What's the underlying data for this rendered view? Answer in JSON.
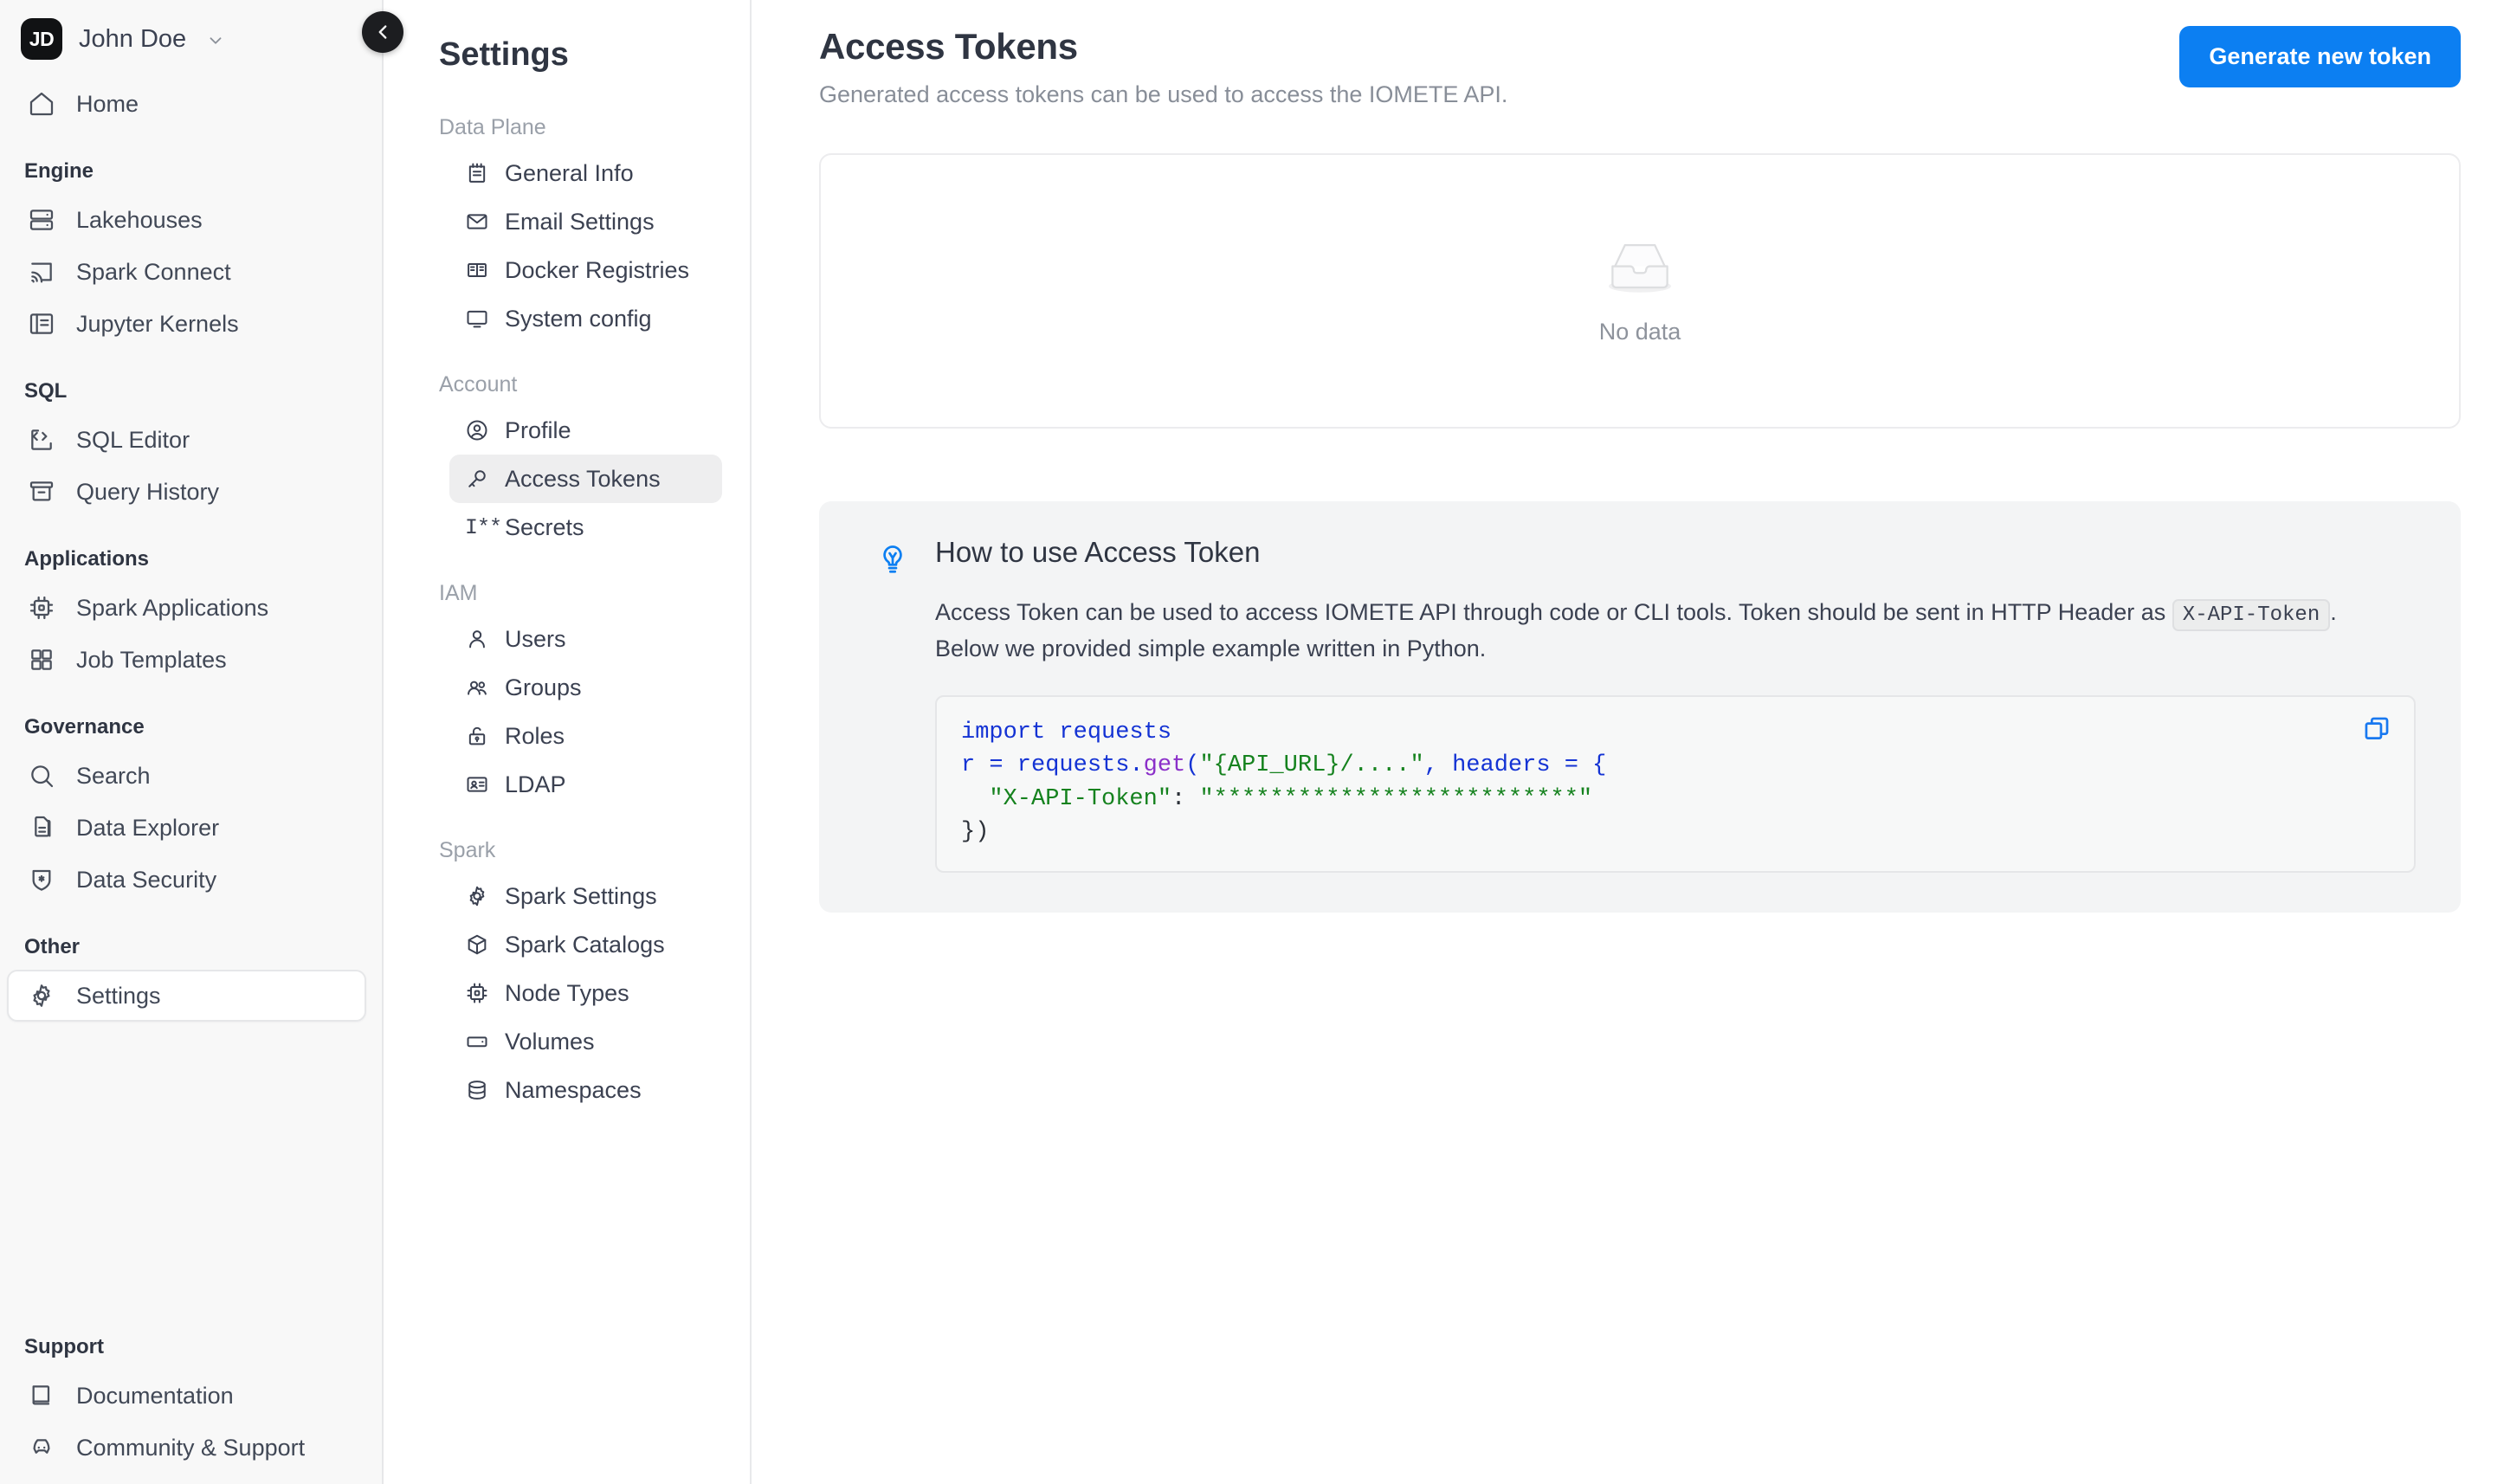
{
  "left_nav": {
    "user": {
      "initials": "JD",
      "name": "John Doe"
    },
    "collapse_tooltip": "Collapse sidebar",
    "top_item": {
      "label": "Home",
      "icon": "home-icon"
    },
    "groups": [
      {
        "label": "Engine",
        "items": [
          {
            "label": "Lakehouses",
            "icon": "server-icon"
          },
          {
            "label": "Spark Connect",
            "icon": "cast-icon"
          },
          {
            "label": "Jupyter Kernels",
            "icon": "notebook-icon"
          }
        ]
      },
      {
        "label": "SQL",
        "items": [
          {
            "label": "SQL Editor",
            "icon": "code-icon"
          },
          {
            "label": "Query History",
            "icon": "archive-icon"
          }
        ]
      },
      {
        "label": "Applications",
        "items": [
          {
            "label": "Spark Applications",
            "icon": "cpu-icon"
          },
          {
            "label": "Job Templates",
            "icon": "grid-icon"
          }
        ]
      },
      {
        "label": "Governance",
        "items": [
          {
            "label": "Search",
            "icon": "search-icon"
          },
          {
            "label": "Data Explorer",
            "icon": "files-icon"
          },
          {
            "label": "Data Security",
            "icon": "shield-icon"
          }
        ]
      },
      {
        "label": "Other",
        "items": [
          {
            "label": "Settings",
            "icon": "gear-icon",
            "selected": true
          }
        ]
      }
    ],
    "bottom_group": {
      "label": "Support",
      "items": [
        {
          "label": "Documentation",
          "icon": "book-icon"
        },
        {
          "label": "Community & Support",
          "icon": "discord-icon"
        }
      ]
    }
  },
  "subnav": {
    "title": "Settings",
    "groups": [
      {
        "label": "Data Plane",
        "items": [
          {
            "label": "General Info",
            "icon": "notepad-icon"
          },
          {
            "label": "Email Settings",
            "icon": "mail-icon"
          },
          {
            "label": "Docker Registries",
            "icon": "registry-icon"
          },
          {
            "label": "System config",
            "icon": "monitor-icon"
          }
        ]
      },
      {
        "label": "Account",
        "items": [
          {
            "label": "Profile",
            "icon": "user-circle-icon"
          },
          {
            "label": "Access Tokens",
            "icon": "key-icon",
            "active": true
          },
          {
            "label": "Secrets",
            "icon": "asterisk-icon"
          }
        ]
      },
      {
        "label": "IAM",
        "items": [
          {
            "label": "Users",
            "icon": "user-icon"
          },
          {
            "label": "Groups",
            "icon": "users-icon"
          },
          {
            "label": "Roles",
            "icon": "lock-open-icon"
          },
          {
            "label": "LDAP",
            "icon": "id-card-icon"
          }
        ]
      },
      {
        "label": "Spark",
        "items": [
          {
            "label": "Spark Settings",
            "icon": "gear-icon"
          },
          {
            "label": "Spark Catalogs",
            "icon": "cube-icon"
          },
          {
            "label": "Node Types",
            "icon": "cpu-icon"
          },
          {
            "label": "Volumes",
            "icon": "volume-icon"
          },
          {
            "label": "Namespaces",
            "icon": "database-icon"
          }
        ]
      }
    ]
  },
  "main": {
    "title": "Access Tokens",
    "subtitle": "Generated access tokens can be used to access the IOMETE API.",
    "generate_button": "Generate new token",
    "empty_state": {
      "label": "No data",
      "icon": "empty-box-icon"
    },
    "info": {
      "icon": "lightbulb-icon",
      "title": "How to use Access Token",
      "paragraph_part1": "Access Token can be used to access IOMETE API through code or CLI tools. Token should be sent in HTTP Header as",
      "inline_code": "X-API-Token",
      "paragraph_part2": ".",
      "paragraph_line2": "Below we provided simple example written in Python.",
      "code": {
        "language": "python",
        "copy_icon": "copy-icon",
        "line1_kw": "import",
        "line1_mod": " requests",
        "line2_a": "r = requests.",
        "line2_get": "get",
        "line2_b": "(",
        "line2_url": "\"{API_URL}/....\"",
        "line2_c": ", headers = {",
        "line3_key": "\"X-API-Token\"",
        "line3_colon": ": ",
        "line3_val": "\"**************************\"",
        "line4": "})"
      }
    }
  },
  "colors": {
    "accent": "#0c7ff2",
    "panel_bg": "#f3f4f5",
    "text": "#3b4151",
    "muted": "#9aa0a9"
  }
}
